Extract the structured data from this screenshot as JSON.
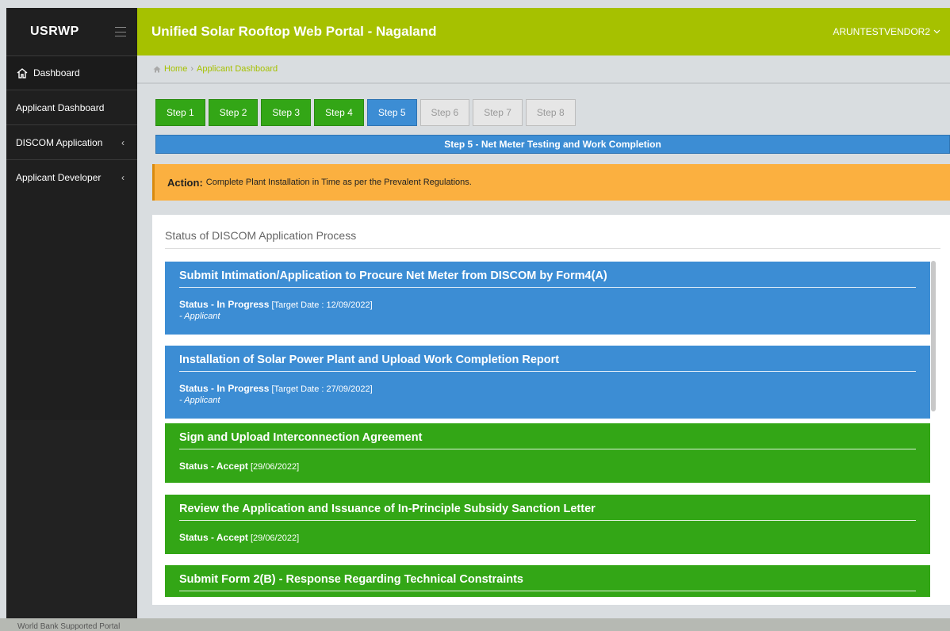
{
  "brand": "USRWP",
  "header": {
    "title": "Unified Solar Rooftop Web Portal - Nagaland",
    "user": "ARUNTESTVENDOR2"
  },
  "sidebar": {
    "items": [
      {
        "label": "Dashboard"
      },
      {
        "label": "Applicant Dashboard"
      },
      {
        "label": "DISCOM Application"
      },
      {
        "label": "Applicant Developer"
      }
    ]
  },
  "breadcrumb": {
    "home": "Home",
    "current": "Applicant Dashboard"
  },
  "steps": [
    "Step 1",
    "Step 2",
    "Step 3",
    "Step 4",
    "Step 5",
    "Step 6",
    "Step 7",
    "Step 8"
  ],
  "step_banner": "Step 5 - Net Meter Testing and Work Completion",
  "action": {
    "label": "Action:",
    "text": "Complete Plant Installation in Time as per the Prevalent Regulations."
  },
  "panel": {
    "title": "Status of DISCOM Application Process",
    "cards": [
      {
        "title": "Submit Intimation/Application to Procure Net Meter from DISCOM by Form4(A)",
        "status": "Status - In Progress",
        "date": "[Target Date : 12/09/2022]",
        "by": "- Applicant"
      },
      {
        "title": "Installation of Solar Power Plant and Upload Work Completion Report",
        "status": "Status - In Progress",
        "date": "[Target Date : 27/09/2022]",
        "by": "- Applicant"
      },
      {
        "title": "Sign and Upload Interconnection Agreement",
        "status": "Status - Accept",
        "date": "[29/06/2022]"
      },
      {
        "title": "Review the Application and Issuance of In-Principle Subsidy Sanction Letter",
        "status": "Status - Accept",
        "date": "[29/06/2022]"
      },
      {
        "title": "Submit Form 2(B) - Response Regarding Technical Constraints"
      }
    ]
  },
  "footer": "World Bank Supported Portal",
  "colors": {
    "header": "#a6c100",
    "blue": "#3c8dd4",
    "green": "#33a616",
    "action": "#fbb040",
    "sidebar": "#1f1f1f"
  }
}
